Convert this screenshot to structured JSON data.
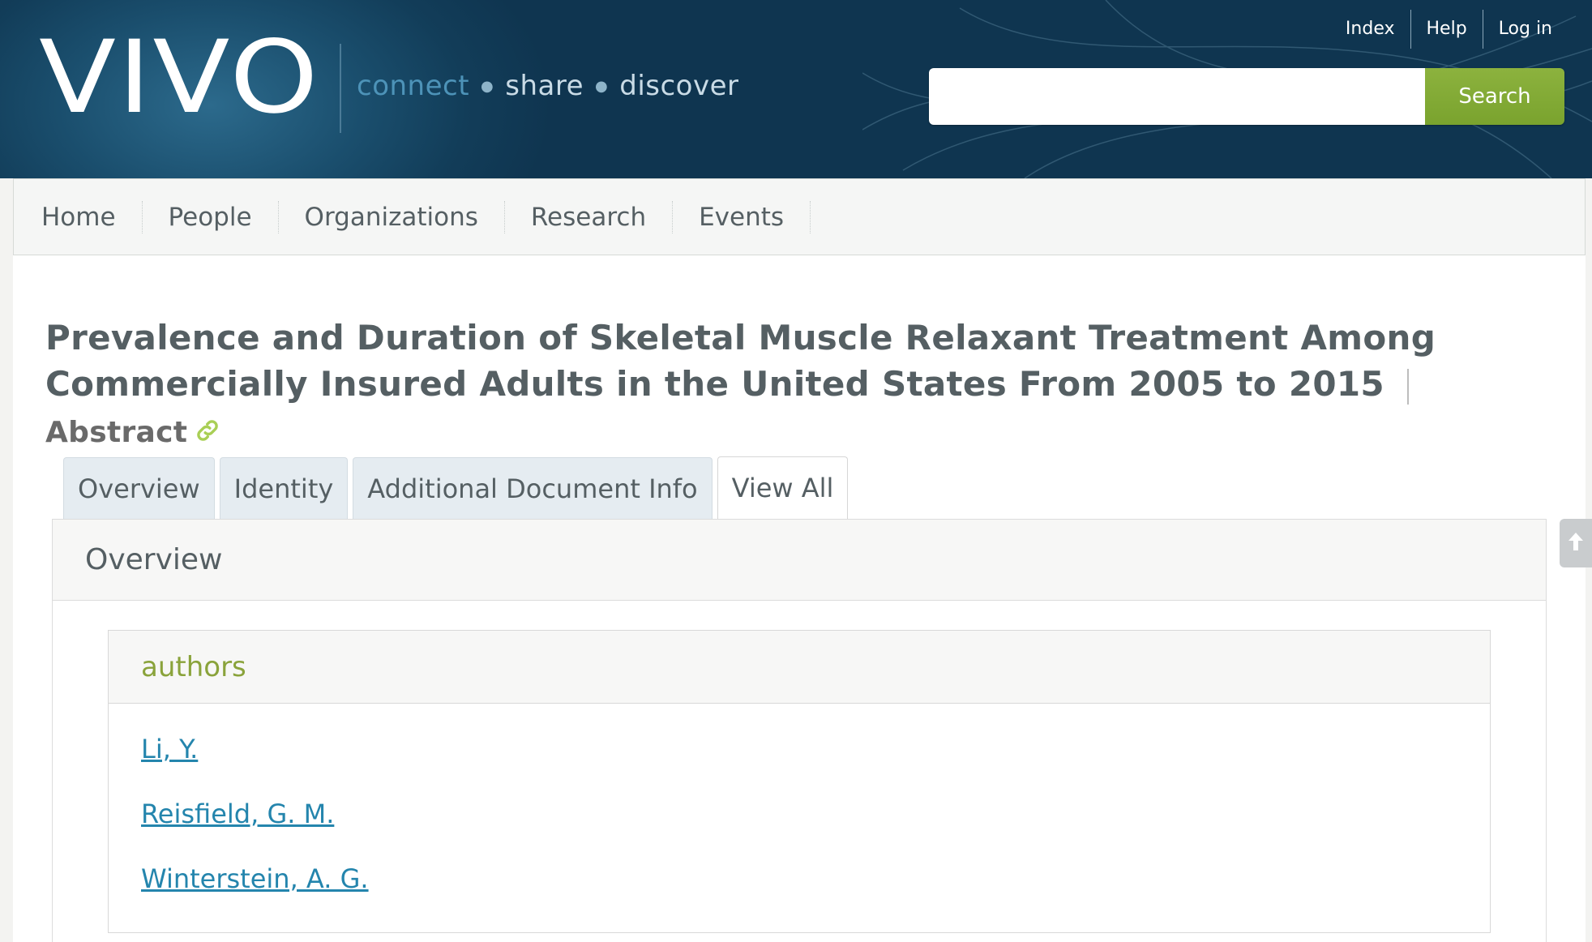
{
  "brand": {
    "logo_text": "VIVO",
    "tagline": [
      "connect",
      "share",
      "discover"
    ]
  },
  "top_links": [
    "Index",
    "Help",
    "Log in"
  ],
  "search": {
    "placeholder": "",
    "button_label": "Search"
  },
  "nav": {
    "items": [
      "Home",
      "People",
      "Organizations",
      "Research",
      "Events"
    ]
  },
  "document": {
    "title": "Prevalence and Duration of Skeletal Muscle Relaxant Treatment Among Commercially Insured Adults in the United States From 2005 to 2015",
    "type_label": "Abstract"
  },
  "tabs": {
    "items": [
      "Overview",
      "Identity",
      "Additional Document Info",
      "View All"
    ],
    "active": "View All"
  },
  "panel": {
    "title": "Overview"
  },
  "authors": {
    "label": "authors",
    "list": [
      "Li, Y.",
      "Reisfield, G. M.",
      "Winterstein, A. G."
    ]
  },
  "colors": {
    "header_bg": "#123d59",
    "accent_green": "#7aa32e",
    "link_blue": "#2485ad",
    "tab_bg": "#e5ecf1"
  },
  "icons": {
    "permalink": "link-icon",
    "back_to_top": "arrow-up-icon"
  }
}
